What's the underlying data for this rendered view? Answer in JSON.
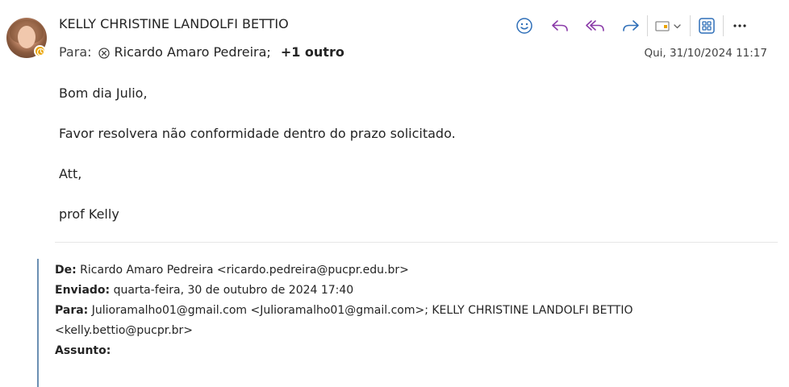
{
  "header": {
    "sender_name": "KELLY CHRISTINE LANDOLFI BETTIO",
    "to_label": "Para:",
    "recipient": "Ricardo Amaro Pedreira;",
    "more_recipients": "+1 outro",
    "date": "Qui, 31/10/2024 11:17"
  },
  "toolbar": {
    "emoji_icon": "smiley-icon",
    "reply_icon": "reply-icon",
    "reply_all_icon": "reply-all-icon",
    "forward_icon": "forward-icon",
    "immersive_icon": "immersive-reader-icon",
    "apps_icon": "apps-icon",
    "more_icon": "more-icon"
  },
  "body": {
    "greeting": "Bom dia Julio,",
    "line1": "Favor resolvera não conformidade dentro do prazo solicitado.",
    "closing": "Att,",
    "signature": "prof Kelly"
  },
  "quoted": {
    "from_label": "De:",
    "from_value": "Ricardo Amaro Pedreira <ricardo.pedreira@pucpr.edu.br>",
    "sent_label": "Enviado:",
    "sent_value": "quarta-feira, 30 de outubro de 2024 17:40",
    "to_label": "Para:",
    "to_value_line1": "Julioramalho01@gmail.com <Julioramalho01@gmail.com>; KELLY CHRISTINE LANDOLFI BETTIO",
    "to_value_line2": "<kelly.bettio@pucpr.br>",
    "subject_label": "Assunto:"
  },
  "colors": {
    "accent_blue": "#2f6fb8",
    "reply_purple": "#8a3aa8",
    "presence_away": "#eaa300"
  }
}
